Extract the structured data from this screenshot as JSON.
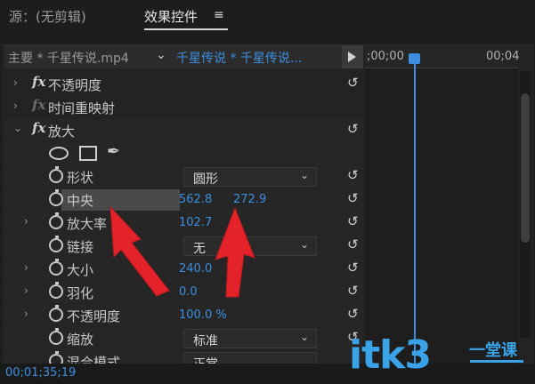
{
  "tabs": {
    "source": "源：(无剪辑)",
    "effects": "效果控件",
    "menu_icon": "≡"
  },
  "header": {
    "master": "主要 * 千星传说.mp4",
    "sequence": "千星传说 * 千星传说..."
  },
  "timeline": {
    "time_start": ";00;00",
    "time_end": "00;04"
  },
  "effects": {
    "opacity": "不透明度",
    "time_remap": "时间重映射",
    "magnify": "放大",
    "shape": {
      "label": "形状",
      "value": "圆形"
    },
    "center": {
      "label": "中央",
      "x": "562.8",
      "y": "272.9"
    },
    "magnification": {
      "label": "放大率",
      "value": "102.7"
    },
    "link": {
      "label": "链接",
      "value": "无"
    },
    "size": {
      "label": "大小",
      "value": "240.0"
    },
    "feather": {
      "label": "羽化",
      "value": "0.0"
    },
    "opacity_prop": {
      "label": "不透明度",
      "value": "100.0 %"
    },
    "scaling": {
      "label": "缩放",
      "value": "标准"
    },
    "blend_mode": {
      "label": "混合模式",
      "value": "正常"
    }
  },
  "footer": {
    "timecode": "00;01;35;19"
  },
  "watermark": {
    "text": "itk3",
    "sub": "一堂课"
  },
  "colors": {
    "accent": "#3c8fe0",
    "arrow": "#e3222a",
    "watermark": "#3aa3e8"
  },
  "icons": [
    "chevron-right-icon",
    "chevron-down-icon",
    "fx-icon",
    "reset-icon",
    "stopwatch-icon",
    "ellipse-tool-icon",
    "rectangle-tool-icon",
    "pen-tool-icon",
    "play-icon",
    "menu-icon"
  ]
}
